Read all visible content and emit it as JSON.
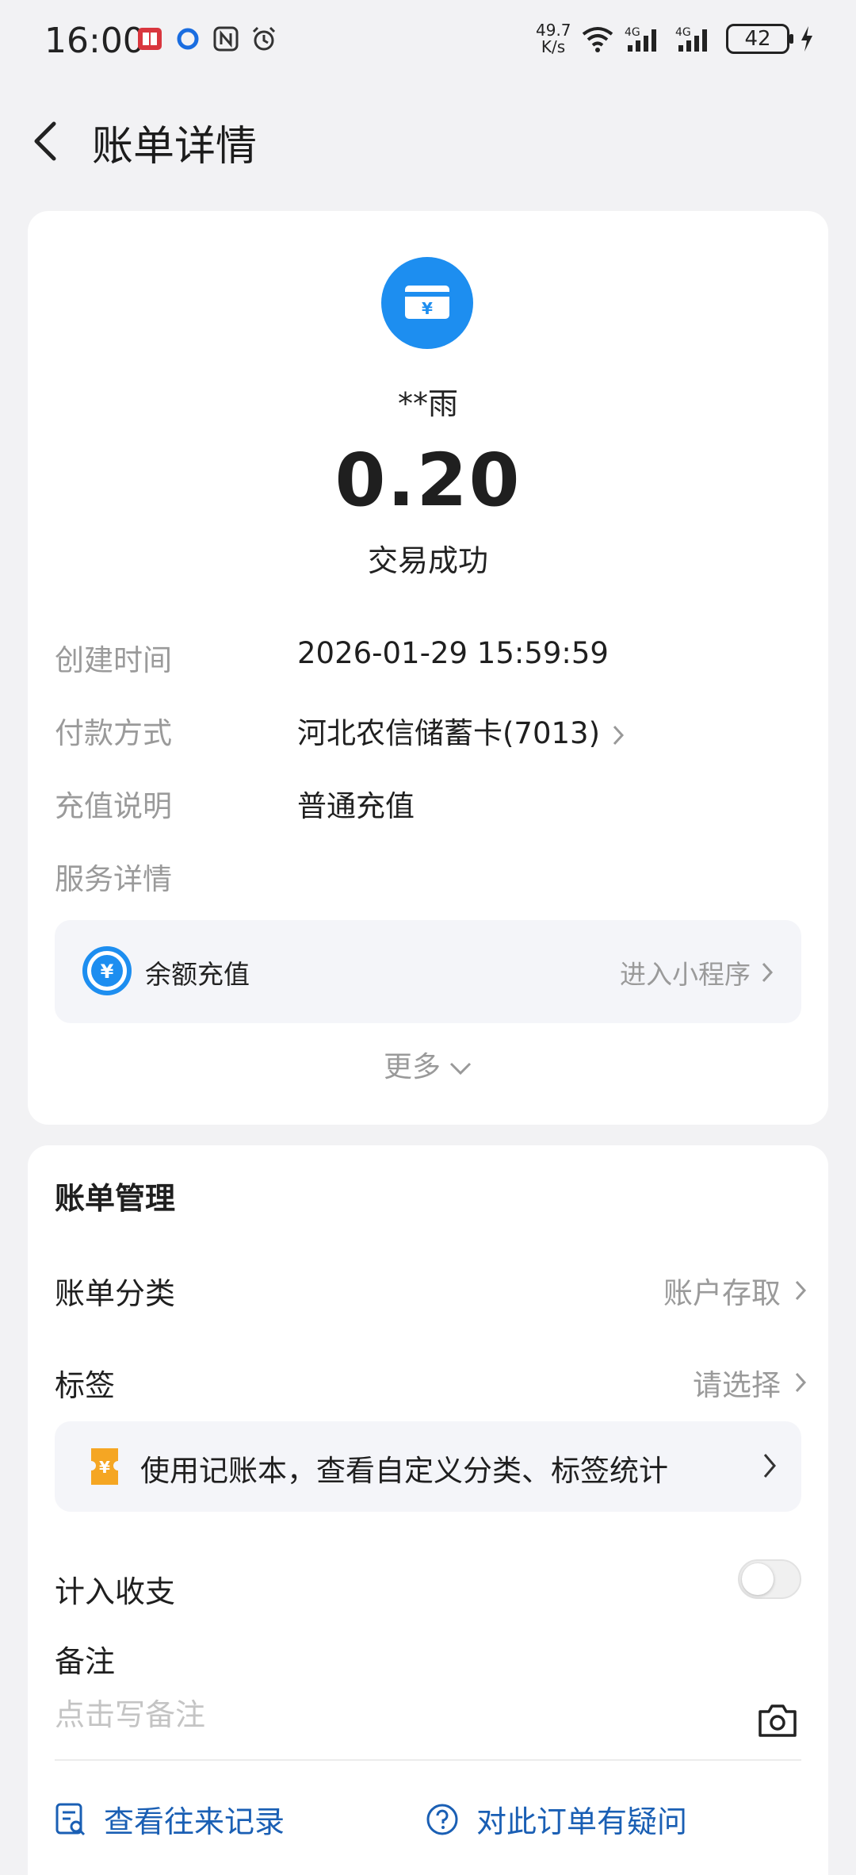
{
  "status_bar": {
    "time": "16:00",
    "net_speed_value": "49.7",
    "net_speed_unit": "K/s",
    "battery": "42",
    "signal_label": "4G"
  },
  "header": {
    "title": "账单详情",
    "back_icon": "chevron-left-icon"
  },
  "summary": {
    "merchant_icon": "card-yuan-icon",
    "merchant_name": "**雨",
    "amount": "0.20",
    "status": "交易成功",
    "accent_color": "#1d8ef0"
  },
  "details": [
    {
      "label": "创建时间",
      "value": "2026-01-29 15:59:59"
    },
    {
      "label": "付款方式",
      "value": "河北农信储蓄卡(7013)"
    },
    {
      "label": "充值说明",
      "value": "普通充值"
    },
    {
      "label": "服务详情",
      "value": ""
    }
  ],
  "service": {
    "icon": "yuan-circle-icon",
    "label": "余额充值",
    "link": "进入小程序"
  },
  "more_label": "更多",
  "management": {
    "title": "账单管理",
    "category_label": "账单分类",
    "category_value": "账户存取",
    "tag_label": "标签",
    "tag_value": "请选择",
    "promo_text": "使用记账本，查看自定义分类、标签统计",
    "include_label": "计入收支",
    "include_enabled": false,
    "note_label": "备注",
    "note_placeholder": "点击写备注"
  },
  "actions": {
    "history": "查看往来记录",
    "question": "对此订单有疑问",
    "link_color": "#1a5fb4"
  }
}
